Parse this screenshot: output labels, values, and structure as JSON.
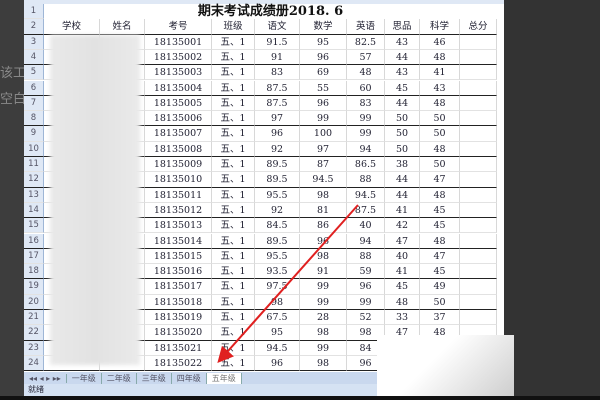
{
  "left_text": [
    "该工",
    "空白"
  ],
  "title": "期末考试成绩册2018. 6",
  "headers": [
    "学校",
    "姓名",
    "考号",
    "班级",
    "语文",
    "数学",
    "英语",
    "思品",
    "科学",
    "总分"
  ],
  "rows": [
    [
      "18135001",
      "五、1",
      "91.5",
      "95",
      "82.5",
      "43",
      "46"
    ],
    [
      "18135002",
      "五、1",
      "91",
      "96",
      "57",
      "44",
      "48"
    ],
    [
      "18135003",
      "五、1",
      "83",
      "69",
      "48",
      "43",
      "41"
    ],
    [
      "18135004",
      "五、1",
      "87.5",
      "55",
      "60",
      "45",
      "43"
    ],
    [
      "18135005",
      "五、1",
      "87.5",
      "96",
      "83",
      "44",
      "48"
    ],
    [
      "18135006",
      "五、1",
      "97",
      "99",
      "99",
      "50",
      "50"
    ],
    [
      "18135007",
      "五、1",
      "96",
      "100",
      "99",
      "50",
      "50"
    ],
    [
      "18135008",
      "五、1",
      "92",
      "97",
      "94",
      "50",
      "48"
    ],
    [
      "18135009",
      "五、1",
      "89.5",
      "87",
      "86.5",
      "38",
      "50"
    ],
    [
      "18135010",
      "五、1",
      "89.5",
      "94.5",
      "88",
      "44",
      "47"
    ],
    [
      "18135011",
      "五、1",
      "95.5",
      "98",
      "94.5",
      "44",
      "48"
    ],
    [
      "18135012",
      "五、1",
      "92",
      "81",
      "87.5",
      "41",
      "45"
    ],
    [
      "18135013",
      "五、1",
      "84.5",
      "86",
      "40",
      "42",
      "45"
    ],
    [
      "18135014",
      "五、1",
      "89.5",
      "96",
      "94",
      "47",
      "48"
    ],
    [
      "18135015",
      "五、1",
      "95.5",
      "98",
      "88",
      "40",
      "47"
    ],
    [
      "18135016",
      "五、1",
      "93.5",
      "91",
      "59",
      "41",
      "45"
    ],
    [
      "18135017",
      "五、1",
      "97.5",
      "99",
      "96",
      "45",
      "49"
    ],
    [
      "18135018",
      "五、1",
      "98",
      "99",
      "99",
      "48",
      "50"
    ],
    [
      "18135019",
      "五、1",
      "67.5",
      "28",
      "52",
      "33",
      "37"
    ],
    [
      "18135020",
      "五、1",
      "95",
      "98",
      "98",
      "47",
      "48"
    ],
    [
      "18135021",
      "五、1",
      "94.5",
      "99",
      "84",
      "",
      ""
    ],
    [
      "18135022",
      "五、1",
      "96",
      "98",
      "96",
      "",
      ""
    ]
  ],
  "sheet_tabs": [
    "一年级",
    "二年级",
    "三年级",
    "四年级",
    "五年级"
  ],
  "active_tab": 4,
  "status": "就绪",
  "arrow_color": "#e02020"
}
